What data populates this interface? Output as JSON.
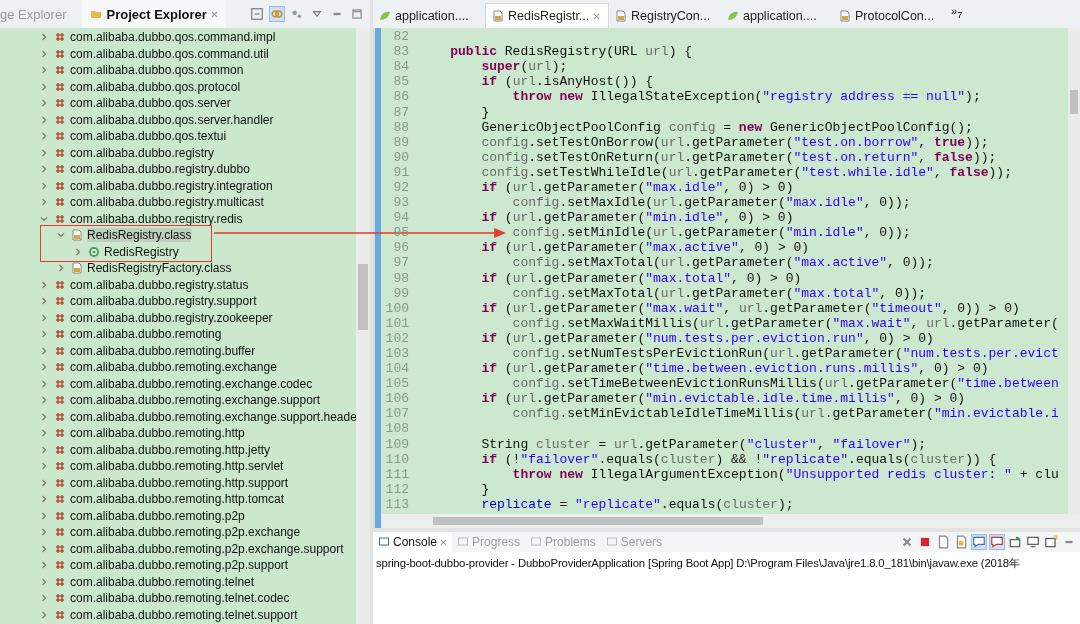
{
  "left_panel": {
    "tabs": [
      {
        "label": "ge Explorer",
        "selected": false,
        "kind": "package"
      },
      {
        "label": "Project Explorer",
        "selected": true,
        "kind": "project"
      }
    ],
    "tree": [
      {
        "label": "com.alibaba.dubbo.qos.command.impl",
        "kind": "package",
        "expanded": false,
        "selected": false
      },
      {
        "label": "com.alibaba.dubbo.qos.command.util",
        "kind": "package",
        "expanded": false,
        "selected": false
      },
      {
        "label": "com.alibaba.dubbo.qos.common",
        "kind": "package",
        "expanded": false,
        "selected": false
      },
      {
        "label": "com.alibaba.dubbo.qos.protocol",
        "kind": "package",
        "expanded": false,
        "selected": false
      },
      {
        "label": "com.alibaba.dubbo.qos.server",
        "kind": "package",
        "expanded": false,
        "selected": false
      },
      {
        "label": "com.alibaba.dubbo.qos.server.handler",
        "kind": "package",
        "expanded": false,
        "selected": false
      },
      {
        "label": "com.alibaba.dubbo.qos.textui",
        "kind": "package",
        "expanded": false,
        "selected": false
      },
      {
        "label": "com.alibaba.dubbo.registry",
        "kind": "package",
        "expanded": false,
        "selected": false
      },
      {
        "label": "com.alibaba.dubbo.registry.dubbo",
        "kind": "package",
        "expanded": false,
        "selected": false
      },
      {
        "label": "com.alibaba.dubbo.registry.integration",
        "kind": "package",
        "expanded": false,
        "selected": false
      },
      {
        "label": "com.alibaba.dubbo.registry.multicast",
        "kind": "package",
        "expanded": false,
        "selected": false
      },
      {
        "label": "com.alibaba.dubbo.registry.redis",
        "kind": "package",
        "expanded": true,
        "selected": false,
        "children": [
          {
            "label": "RedisRegistry.class",
            "kind": "classfile",
            "expanded": true,
            "selected": true,
            "children": [
              {
                "label": "RedisRegistry",
                "kind": "type",
                "expanded": false,
                "selected": false
              }
            ]
          },
          {
            "label": "RedisRegistryFactory.class",
            "kind": "classfile",
            "expanded": false,
            "selected": false
          }
        ]
      },
      {
        "label": "com.alibaba.dubbo.registry.status",
        "kind": "package",
        "expanded": false,
        "selected": false
      },
      {
        "label": "com.alibaba.dubbo.registry.support",
        "kind": "package",
        "expanded": false,
        "selected": false
      },
      {
        "label": "com.alibaba.dubbo.registry.zookeeper",
        "kind": "package",
        "expanded": false,
        "selected": false
      },
      {
        "label": "com.alibaba.dubbo.remoting",
        "kind": "package",
        "expanded": false,
        "selected": false
      },
      {
        "label": "com.alibaba.dubbo.remoting.buffer",
        "kind": "package",
        "expanded": false,
        "selected": false
      },
      {
        "label": "com.alibaba.dubbo.remoting.exchange",
        "kind": "package",
        "expanded": false,
        "selected": false
      },
      {
        "label": "com.alibaba.dubbo.remoting.exchange.codec",
        "kind": "package",
        "expanded": false,
        "selected": false
      },
      {
        "label": "com.alibaba.dubbo.remoting.exchange.support",
        "kind": "package",
        "expanded": false,
        "selected": false
      },
      {
        "label": "com.alibaba.dubbo.remoting.exchange.support.heade",
        "kind": "package",
        "expanded": false,
        "selected": false
      },
      {
        "label": "com.alibaba.dubbo.remoting.http",
        "kind": "package",
        "expanded": false,
        "selected": false
      },
      {
        "label": "com.alibaba.dubbo.remoting.http.jetty",
        "kind": "package",
        "expanded": false,
        "selected": false
      },
      {
        "label": "com.alibaba.dubbo.remoting.http.servlet",
        "kind": "package",
        "expanded": false,
        "selected": false
      },
      {
        "label": "com.alibaba.dubbo.remoting.http.support",
        "kind": "package",
        "expanded": false,
        "selected": false
      },
      {
        "label": "com.alibaba.dubbo.remoting.http.tomcat",
        "kind": "package",
        "expanded": false,
        "selected": false
      },
      {
        "label": "com.alibaba.dubbo.remoting.p2p",
        "kind": "package",
        "expanded": false,
        "selected": false
      },
      {
        "label": "com.alibaba.dubbo.remoting.p2p.exchange",
        "kind": "package",
        "expanded": false,
        "selected": false
      },
      {
        "label": "com.alibaba.dubbo.remoting.p2p.exchange.support",
        "kind": "package",
        "expanded": false,
        "selected": false
      },
      {
        "label": "com.alibaba.dubbo.remoting.p2p.support",
        "kind": "package",
        "expanded": false,
        "selected": false
      },
      {
        "label": "com.alibaba.dubbo.remoting.telnet",
        "kind": "package",
        "expanded": false,
        "selected": false
      },
      {
        "label": "com.alibaba.dubbo.remoting.telnet.codec",
        "kind": "package",
        "expanded": false,
        "selected": false
      },
      {
        "label": "com.alibaba.dubbo.remoting.telnet.support",
        "kind": "package",
        "expanded": false,
        "selected": false
      }
    ]
  },
  "editor": {
    "tabs": [
      {
        "label": "application....",
        "kind": "yml",
        "selected": false
      },
      {
        "label": "RedisRegistr...",
        "kind": "class",
        "selected": true
      },
      {
        "label": "RegistryCon...",
        "kind": "class",
        "selected": false
      },
      {
        "label": "application....",
        "kind": "yml",
        "selected": false
      },
      {
        "label": "ProtocolCon...",
        "kind": "class",
        "selected": false
      }
    ],
    "overflow": {
      "mark": "»",
      "count": "7"
    },
    "lines": [
      {
        "number": "82"
      },
      {
        "number": "83",
        "code": [
          {
            "kind": "keyword",
            "text": "    public"
          },
          {
            "kind": "plain",
            "text": " RedisRegistry(URL "
          },
          {
            "kind": "variable",
            "text": "url"
          },
          {
            "kind": "plain",
            "text": ") {"
          }
        ]
      },
      {
        "number": "84",
        "code": [
          {
            "kind": "keyword",
            "text": "        super"
          },
          {
            "kind": "plain",
            "text": "("
          },
          {
            "kind": "variable",
            "text": "url"
          },
          {
            "kind": "plain",
            "text": ");"
          }
        ]
      },
      {
        "number": "85",
        "code": [
          {
            "kind": "keyword",
            "text": "        if"
          },
          {
            "kind": "plain",
            "text": " ("
          },
          {
            "kind": "variable",
            "text": "url"
          },
          {
            "kind": "plain",
            "text": ".isAnyHost()) {"
          }
        ]
      },
      {
        "number": "86",
        "code": [
          {
            "kind": "keyword",
            "text": "            throw new"
          },
          {
            "kind": "plain",
            "text": " IllegalStateException("
          },
          {
            "kind": "string",
            "text": "\"registry address == null\""
          },
          {
            "kind": "plain",
            "text": ");"
          }
        ]
      },
      {
        "number": "87",
        "code": [
          {
            "kind": "plain",
            "text": "        }"
          }
        ]
      },
      {
        "number": "88",
        "code": [
          {
            "kind": "plain",
            "text": "        GenericObjectPoolConfig "
          },
          {
            "kind": "variable",
            "text": "config"
          },
          {
            "kind": "plain",
            "text": " = "
          },
          {
            "kind": "keyword",
            "text": "new"
          },
          {
            "kind": "plain",
            "text": " GenericObjectPoolConfig();"
          }
        ]
      },
      {
        "number": "89",
        "code": [
          {
            "kind": "variable",
            "text": "        config"
          },
          {
            "kind": "plain",
            "text": ".setTestOnBorrow("
          },
          {
            "kind": "variable",
            "text": "url"
          },
          {
            "kind": "plain",
            "text": ".getParameter("
          },
          {
            "kind": "string",
            "text": "\"test.on.borrow\""
          },
          {
            "kind": "plain",
            "text": ", "
          },
          {
            "kind": "keyword",
            "text": "true"
          },
          {
            "kind": "plain",
            "text": "));"
          }
        ]
      },
      {
        "number": "90",
        "code": [
          {
            "kind": "variable",
            "text": "        config"
          },
          {
            "kind": "plain",
            "text": ".setTestOnReturn("
          },
          {
            "kind": "variable",
            "text": "url"
          },
          {
            "kind": "plain",
            "text": ".getParameter("
          },
          {
            "kind": "string",
            "text": "\"test.on.return\""
          },
          {
            "kind": "plain",
            "text": ", "
          },
          {
            "kind": "keyword",
            "text": "false"
          },
          {
            "kind": "plain",
            "text": "));"
          }
        ]
      },
      {
        "number": "91",
        "code": [
          {
            "kind": "variable",
            "text": "        config"
          },
          {
            "kind": "plain",
            "text": ".setTestWhileIdle("
          },
          {
            "kind": "variable",
            "text": "url"
          },
          {
            "kind": "plain",
            "text": ".getParameter("
          },
          {
            "kind": "string",
            "text": "\"test.while.idle\""
          },
          {
            "kind": "plain",
            "text": ", "
          },
          {
            "kind": "keyword",
            "text": "false"
          },
          {
            "kind": "plain",
            "text": "));"
          }
        ]
      },
      {
        "number": "92",
        "code": [
          {
            "kind": "keyword",
            "text": "        if"
          },
          {
            "kind": "plain",
            "text": " ("
          },
          {
            "kind": "variable",
            "text": "url"
          },
          {
            "kind": "plain",
            "text": ".getParameter("
          },
          {
            "kind": "string",
            "text": "\"max.idle\""
          },
          {
            "kind": "plain",
            "text": ", 0) > 0)"
          }
        ]
      },
      {
        "number": "93",
        "code": [
          {
            "kind": "variable",
            "text": "            config"
          },
          {
            "kind": "plain",
            "text": ".setMaxIdle("
          },
          {
            "kind": "variable",
            "text": "url"
          },
          {
            "kind": "plain",
            "text": ".getParameter("
          },
          {
            "kind": "string",
            "text": "\"max.idle\""
          },
          {
            "kind": "plain",
            "text": ", 0));"
          }
        ]
      },
      {
        "number": "94",
        "code": [
          {
            "kind": "keyword",
            "text": "        if"
          },
          {
            "kind": "plain",
            "text": " ("
          },
          {
            "kind": "variable",
            "text": "url"
          },
          {
            "kind": "plain",
            "text": ".getParameter("
          },
          {
            "kind": "string",
            "text": "\"min.idle\""
          },
          {
            "kind": "plain",
            "text": ", 0) > 0)"
          }
        ]
      },
      {
        "number": "95",
        "code": [
          {
            "kind": "variable",
            "text": "            config"
          },
          {
            "kind": "plain",
            "text": ".setMinIdle("
          },
          {
            "kind": "variable",
            "text": "url"
          },
          {
            "kind": "plain",
            "text": ".getParameter("
          },
          {
            "kind": "string",
            "text": "\"min.idle\""
          },
          {
            "kind": "plain",
            "text": ", 0));"
          }
        ]
      },
      {
        "number": "96",
        "code": [
          {
            "kind": "keyword",
            "text": "        if"
          },
          {
            "kind": "plain",
            "text": " ("
          },
          {
            "kind": "variable",
            "text": "url"
          },
          {
            "kind": "plain",
            "text": ".getParameter("
          },
          {
            "kind": "string",
            "text": "\"max.active\""
          },
          {
            "kind": "plain",
            "text": ", 0) > 0)"
          }
        ]
      },
      {
        "number": "97",
        "code": [
          {
            "kind": "variable",
            "text": "            config"
          },
          {
            "kind": "plain",
            "text": ".setMaxTotal("
          },
          {
            "kind": "variable",
            "text": "url"
          },
          {
            "kind": "plain",
            "text": ".getParameter("
          },
          {
            "kind": "string",
            "text": "\"max.active\""
          },
          {
            "kind": "plain",
            "text": ", 0));"
          }
        ]
      },
      {
        "number": "98",
        "code": [
          {
            "kind": "keyword",
            "text": "        if"
          },
          {
            "kind": "plain",
            "text": " ("
          },
          {
            "kind": "variable",
            "text": "url"
          },
          {
            "kind": "plain",
            "text": ".getParameter("
          },
          {
            "kind": "string",
            "text": "\"max.total\""
          },
          {
            "kind": "plain",
            "text": ", 0) > 0)"
          }
        ]
      },
      {
        "number": "99",
        "code": [
          {
            "kind": "variable",
            "text": "            config"
          },
          {
            "kind": "plain",
            "text": ".setMaxTotal("
          },
          {
            "kind": "variable",
            "text": "url"
          },
          {
            "kind": "plain",
            "text": ".getParameter("
          },
          {
            "kind": "string",
            "text": "\"max.total\""
          },
          {
            "kind": "plain",
            "text": ", 0));"
          }
        ]
      },
      {
        "number": "100",
        "code": [
          {
            "kind": "keyword",
            "text": "        if"
          },
          {
            "kind": "plain",
            "text": " ("
          },
          {
            "kind": "variable",
            "text": "url"
          },
          {
            "kind": "plain",
            "text": ".getParameter("
          },
          {
            "kind": "string",
            "text": "\"max.wait\""
          },
          {
            "kind": "plain",
            "text": ", "
          },
          {
            "kind": "variable",
            "text": "url"
          },
          {
            "kind": "plain",
            "text": ".getParameter("
          },
          {
            "kind": "string",
            "text": "\"timeout\""
          },
          {
            "kind": "plain",
            "text": ", 0)) > 0)"
          }
        ]
      },
      {
        "number": "101",
        "code": [
          {
            "kind": "variable",
            "text": "            config"
          },
          {
            "kind": "plain",
            "text": ".setMaxWaitMillis("
          },
          {
            "kind": "variable",
            "text": "url"
          },
          {
            "kind": "plain",
            "text": ".getParameter("
          },
          {
            "kind": "string",
            "text": "\"max.wait\""
          },
          {
            "kind": "plain",
            "text": ", "
          },
          {
            "kind": "variable",
            "text": "url"
          },
          {
            "kind": "plain",
            "text": ".getParameter("
          }
        ]
      },
      {
        "number": "102",
        "code": [
          {
            "kind": "keyword",
            "text": "        if"
          },
          {
            "kind": "plain",
            "text": " ("
          },
          {
            "kind": "variable",
            "text": "url"
          },
          {
            "kind": "plain",
            "text": ".getParameter("
          },
          {
            "kind": "string",
            "text": "\"num.tests.per.eviction.run\""
          },
          {
            "kind": "plain",
            "text": ", 0) > 0)"
          }
        ]
      },
      {
        "number": "103",
        "code": [
          {
            "kind": "variable",
            "text": "            config"
          },
          {
            "kind": "plain",
            "text": ".setNumTestsPerEvictionRun("
          },
          {
            "kind": "variable",
            "text": "url"
          },
          {
            "kind": "plain",
            "text": ".getParameter("
          },
          {
            "kind": "string",
            "text": "\"num.tests.per.evict"
          }
        ]
      },
      {
        "number": "104",
        "code": [
          {
            "kind": "keyword",
            "text": "        if"
          },
          {
            "kind": "plain",
            "text": " ("
          },
          {
            "kind": "variable",
            "text": "url"
          },
          {
            "kind": "plain",
            "text": ".getParameter("
          },
          {
            "kind": "string",
            "text": "\"time.between.eviction.runs.millis\""
          },
          {
            "kind": "plain",
            "text": ", 0) > 0)"
          }
        ]
      },
      {
        "number": "105",
        "code": [
          {
            "kind": "variable",
            "text": "            config"
          },
          {
            "kind": "plain",
            "text": ".setTimeBetweenEvictionRunsMillis("
          },
          {
            "kind": "variable",
            "text": "url"
          },
          {
            "kind": "plain",
            "text": ".getParameter("
          },
          {
            "kind": "string",
            "text": "\"time.between"
          }
        ]
      },
      {
        "number": "106",
        "code": [
          {
            "kind": "keyword",
            "text": "        if"
          },
          {
            "kind": "plain",
            "text": " ("
          },
          {
            "kind": "variable",
            "text": "url"
          },
          {
            "kind": "plain",
            "text": ".getParameter("
          },
          {
            "kind": "string",
            "text": "\"min.evictable.idle.time.millis\""
          },
          {
            "kind": "plain",
            "text": ", 0) > 0)"
          }
        ]
      },
      {
        "number": "107",
        "code": [
          {
            "kind": "variable",
            "text": "            config"
          },
          {
            "kind": "plain",
            "text": ".setMinEvictableIdleTimeMillis("
          },
          {
            "kind": "variable",
            "text": "url"
          },
          {
            "kind": "plain",
            "text": ".getParameter("
          },
          {
            "kind": "string",
            "text": "\"min.evictable.i"
          }
        ]
      },
      {
        "number": "108"
      },
      {
        "number": "109",
        "code": [
          {
            "kind": "plain",
            "text": "        String "
          },
          {
            "kind": "variable",
            "text": "cluster"
          },
          {
            "kind": "plain",
            "text": " = "
          },
          {
            "kind": "variable",
            "text": "url"
          },
          {
            "kind": "plain",
            "text": ".getParameter("
          },
          {
            "kind": "string",
            "text": "\"cluster\""
          },
          {
            "kind": "plain",
            "text": ", "
          },
          {
            "kind": "string",
            "text": "\"failover\""
          },
          {
            "kind": "plain",
            "text": ");"
          }
        ]
      },
      {
        "number": "110",
        "code": [
          {
            "kind": "keyword",
            "text": "        if"
          },
          {
            "kind": "plain",
            "text": " (!"
          },
          {
            "kind": "string",
            "text": "\"failover\""
          },
          {
            "kind": "plain",
            "text": ".equals("
          },
          {
            "kind": "variable",
            "text": "cluster"
          },
          {
            "kind": "plain",
            "text": ") && !"
          },
          {
            "kind": "string",
            "text": "\"replicate\""
          },
          {
            "kind": "plain",
            "text": ".equals("
          },
          {
            "kind": "variable",
            "text": "cluster"
          },
          {
            "kind": "plain",
            "text": ")) {"
          }
        ]
      },
      {
        "number": "111",
        "code": [
          {
            "kind": "keyword",
            "text": "            throw new"
          },
          {
            "kind": "plain",
            "text": " IllegalArgumentException("
          },
          {
            "kind": "string",
            "text": "\"Unsupported redis cluster: \""
          },
          {
            "kind": "plain",
            "text": " + clu"
          }
        ]
      },
      {
        "number": "112",
        "code": [
          {
            "kind": "plain",
            "text": "        }"
          }
        ]
      },
      {
        "number": "113",
        "code": [
          {
            "kind": "field",
            "text": "        replicate"
          },
          {
            "kind": "plain",
            "text": " = "
          },
          {
            "kind": "string",
            "text": "\"replicate\""
          },
          {
            "kind": "plain",
            "text": ".equals("
          },
          {
            "kind": "variable",
            "text": "cluster"
          },
          {
            "kind": "plain",
            "text": ");"
          }
        ]
      }
    ]
  },
  "console": {
    "tabs": [
      {
        "label": "Console",
        "selected": true,
        "disabled": false
      },
      {
        "label": "Progress",
        "selected": false,
        "disabled": true
      },
      {
        "label": "Problems",
        "selected": false,
        "disabled": true
      },
      {
        "label": "Servers",
        "selected": false,
        "disabled": true
      }
    ],
    "header": "spring-boot-dubbo-provider - DubboProviderApplication [Spring Boot App] D:\\Program Files\\Java\\jre1.8.0_181\\bin\\javaw.exe (2018年"
  },
  "annotation": {
    "kind": "box-arrow"
  }
}
